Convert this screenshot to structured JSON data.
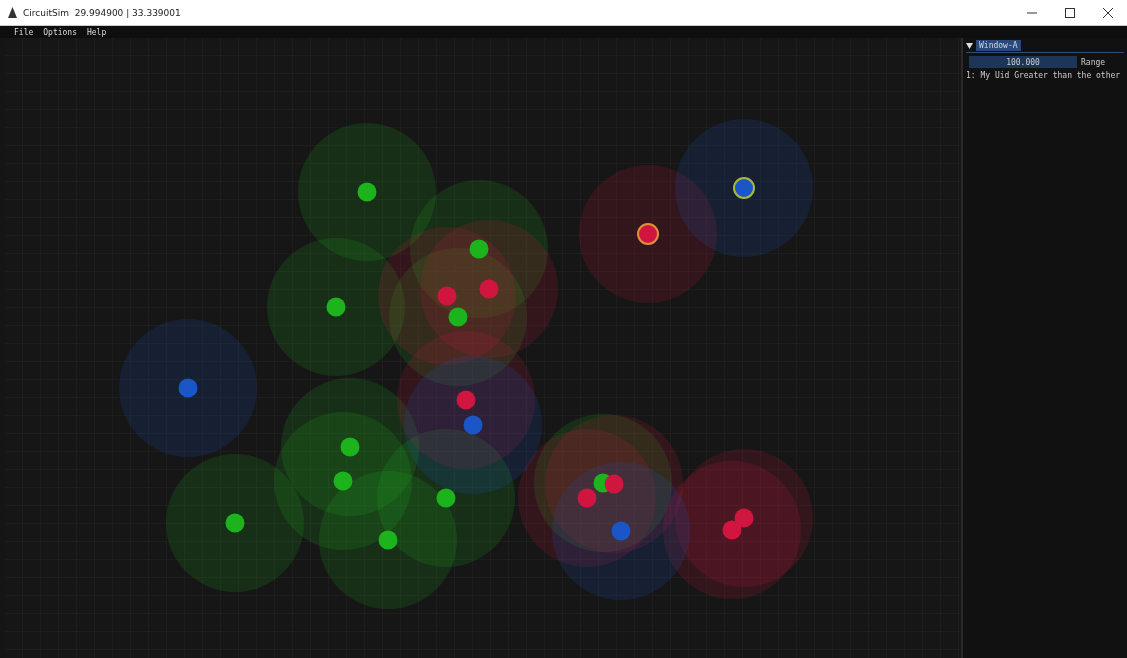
{
  "window": {
    "title": "CircuitSim  29.994900 | 33.339001"
  },
  "menu": [
    "File",
    "Options",
    "Help"
  ],
  "panel": {
    "tab": "Window-A",
    "range": {
      "value": "100.000",
      "label": "Range"
    },
    "log": [
      "1: My Uid Greater than the other"
    ]
  },
  "nodes": [
    {
      "color": "#1db31d",
      "ringed": false
    },
    {
      "color": "#1db31d",
      "ringed": false
    },
    {
      "color": "#1db31d",
      "ringed": false
    },
    {
      "color": "#1db31d",
      "ringed": false
    },
    {
      "color": "#1db31d",
      "ringed": false
    },
    {
      "color": "#1db31d",
      "ringed": false
    },
    {
      "color": "#1db31d",
      "ringed": false
    },
    {
      "color": "#1db31d",
      "ringed": false
    },
    {
      "color": "#1db31d",
      "ringed": false
    },
    {
      "color": "#1db31d",
      "ringed": false
    },
    {
      "color": "#d0163e",
      "ringed": true
    },
    {
      "color": "#d0163e",
      "ringed": false
    },
    {
      "color": "#d0163e",
      "ringed": false
    },
    {
      "color": "#d0163e",
      "ringed": false
    },
    {
      "color": "#d0163e",
      "ringed": false
    },
    {
      "color": "#d0163e",
      "ringed": false
    },
    {
      "color": "#d0163e",
      "ringed": false
    },
    {
      "color": "#d0163e",
      "ringed": false
    },
    {
      "color": "#1a56c8",
      "ringed": true
    },
    {
      "color": "#1a56c8",
      "ringed": false
    },
    {
      "color": "#1a56c8",
      "ringed": false
    },
    {
      "color": "#1a56c8",
      "ringed": false
    }
  ]
}
